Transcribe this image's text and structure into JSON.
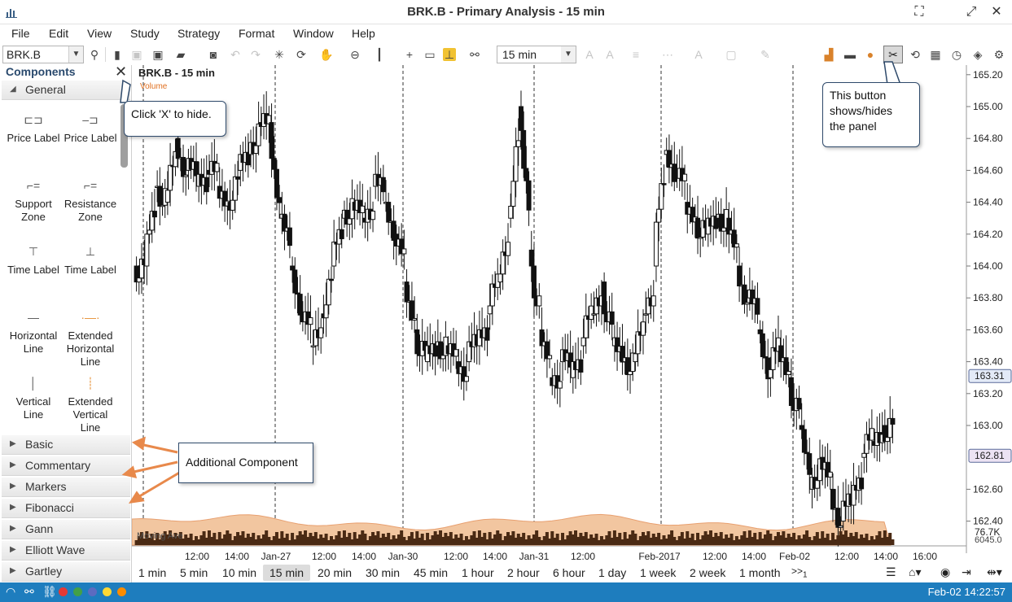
{
  "window": {
    "title": "BRK.B - Primary Analysis - 15 min"
  },
  "menu": [
    "File",
    "Edit",
    "View",
    "Study",
    "Strategy",
    "Format",
    "Window",
    "Help"
  ],
  "toolbar": {
    "symbol": "BRK.B",
    "interval": "15 min"
  },
  "panel": {
    "title": "Components",
    "general_section": "General",
    "components": [
      {
        "label": "Price Label",
        "icon": "price-label-left-icon"
      },
      {
        "label": "Price Label",
        "icon": "price-label-right-icon"
      },
      {
        "label": "Support Zone",
        "icon": "support-zone-icon"
      },
      {
        "label": "Resistance Zone",
        "icon": "resistance-zone-icon"
      },
      {
        "label": "Time Label",
        "icon": "time-label-top-icon"
      },
      {
        "label": "Time Label",
        "icon": "time-label-bottom-icon"
      },
      {
        "label": "Horizontal Line",
        "icon": "horizontal-line-icon"
      },
      {
        "label": "Extended Horizontal Line",
        "icon": "extended-horizontal-line-icon"
      },
      {
        "label": "Vertical Line",
        "icon": "vertical-line-icon"
      },
      {
        "label": "Extended Vertical Line",
        "icon": "extended-vertical-line-icon"
      }
    ],
    "sections": [
      "Basic",
      "Commentary",
      "Markers",
      "Fibonacci",
      "Gann",
      "Elliott Wave",
      "Gartley"
    ]
  },
  "chart": {
    "title": "BRK.B - 15 min",
    "volume_label": "Volume",
    "ma_label": "Moving Ave",
    "last_price": "163.31",
    "bid_price": "162.81",
    "volume_value": "76.7K",
    "volume_base": "6045.0"
  },
  "chart_data": {
    "type": "candlestick",
    "title": "BRK.B - 15 min",
    "y_ticks": [
      "165.20",
      "165.00",
      "164.80",
      "164.60",
      "164.40",
      "164.20",
      "164.00",
      "163.80",
      "163.60",
      "163.40",
      "163.20",
      "163.00",
      "162.60",
      "162.40"
    ],
    "ylim": [
      162.25,
      165.25
    ],
    "x_ticks": [
      "12:00",
      "14:00",
      "Jan-27",
      "12:00",
      "14:00",
      "Jan-30",
      "12:00",
      "14:00",
      "Jan-31",
      "12:00",
      "Feb-2017",
      "12:00",
      "14:00",
      "Feb-02",
      "12:00",
      "14:00",
      "16:00"
    ],
    "day_separators": [
      "Jan-27",
      "Jan-30",
      "Jan-31",
      "Feb-2017",
      "Feb-02"
    ],
    "approx_closes": [
      164.0,
      164.5,
      164.4,
      164.8,
      164.6,
      164.5,
      164.6,
      164.5,
      164.4,
      164.6,
      164.7,
      164.9,
      164.9,
      164.3,
      164.0,
      163.7,
      163.5,
      163.7,
      164.0,
      164.3,
      164.4,
      164.3,
      164.5,
      164.4,
      164.2,
      163.9,
      163.6,
      163.4,
      163.5,
      163.5,
      163.4,
      163.4,
      163.5,
      163.7,
      163.9,
      164.3,
      165.0,
      164.1,
      163.6,
      163.3,
      163.4,
      163.3,
      163.5,
      163.7,
      163.9,
      163.5,
      163.4,
      163.4,
      163.7,
      164.0,
      164.7,
      164.6,
      164.4,
      164.3,
      164.2,
      164.3,
      164.3,
      164.0,
      163.8,
      163.6,
      163.3,
      163.5,
      163.3,
      163.0,
      162.6,
      162.8,
      162.6,
      162.4,
      162.5,
      162.8,
      162.9,
      163.0,
      163.0
    ]
  },
  "intervals": [
    "1 min",
    "5 min",
    "10 min",
    "15 min",
    "20 min",
    "30 min",
    "45 min",
    "1 hour",
    "2 hour",
    "6 hour",
    "1 day",
    "1 week",
    "2 week",
    "1 month"
  ],
  "selected_interval": "15 min",
  "more_intervals": ">>",
  "more_count": "1",
  "status": {
    "time": "Feb-02 14:22:57",
    "dot_colors": [
      "#e53935",
      "#43a047",
      "#5c6bc0",
      "#fdd835",
      "#fb8c00"
    ]
  },
  "callouts": {
    "hide": "Click 'X' to hide.",
    "panel_button": [
      "This button",
      "shows/hides",
      "the panel"
    ],
    "additional": "Additional Component"
  }
}
